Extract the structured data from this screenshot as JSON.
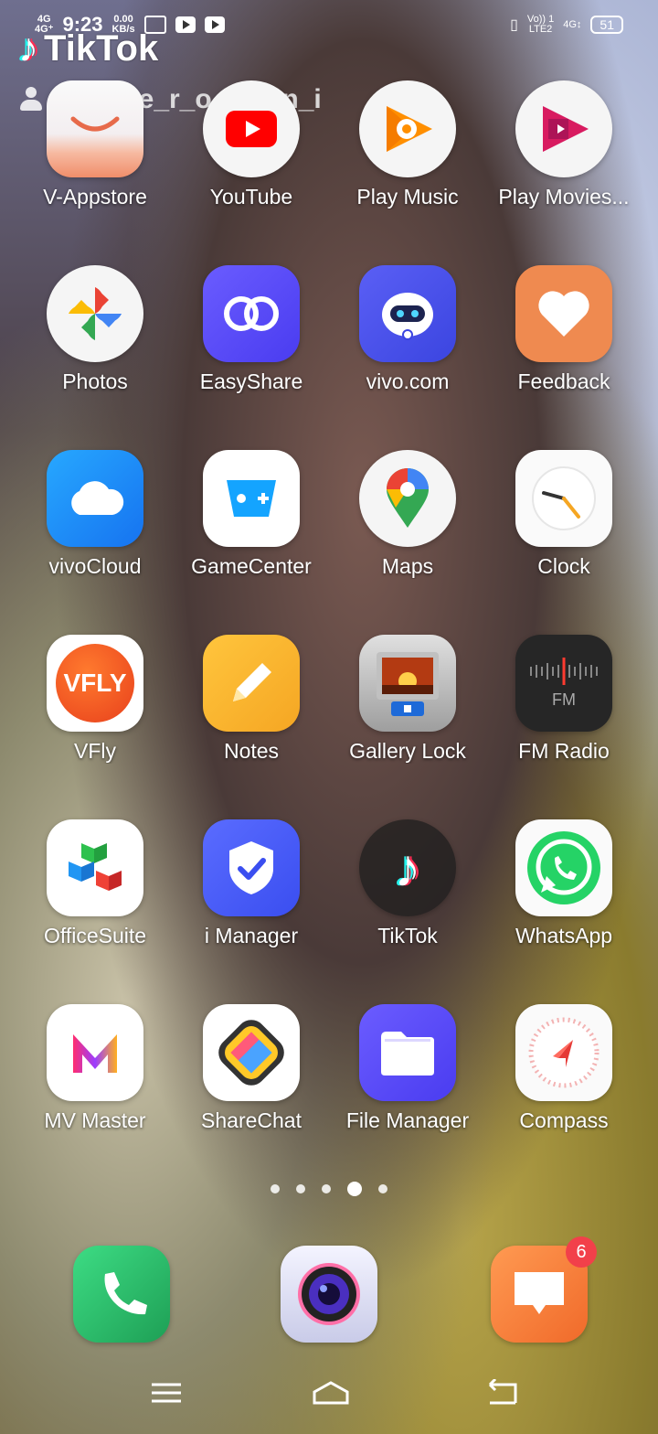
{
  "status_bar": {
    "net_left": "4G",
    "net_left2": "4G⁺",
    "time": "9:23",
    "speed_value": "0.00",
    "speed_unit": "KB/s",
    "volte": "Vo)) 1",
    "lte": "LTE2",
    "net_right": "4G↕",
    "battery": "51"
  },
  "watermark": {
    "brand": "TikTok",
    "username": "@u_s_e_r_o_h_i_n_i"
  },
  "apps": [
    {
      "label": "V-Appstore"
    },
    {
      "label": "YouTube"
    },
    {
      "label": "Play Music"
    },
    {
      "label": "Play Movies..."
    },
    {
      "label": "Photos"
    },
    {
      "label": "EasyShare"
    },
    {
      "label": "vivo.com"
    },
    {
      "label": "Feedback"
    },
    {
      "label": "vivoCloud"
    },
    {
      "label": "GameCenter"
    },
    {
      "label": "Maps"
    },
    {
      "label": "Clock"
    },
    {
      "label": "VFly"
    },
    {
      "label": "Notes"
    },
    {
      "label": "Gallery Lock"
    },
    {
      "label": "FM Radio"
    },
    {
      "label": "OfficeSuite"
    },
    {
      "label": "i Manager"
    },
    {
      "label": "TikTok"
    },
    {
      "label": "WhatsApp"
    },
    {
      "label": "MV Master"
    },
    {
      "label": "ShareChat"
    },
    {
      "label": "File Manager"
    },
    {
      "label": "Compass"
    }
  ],
  "vfly_text": "VFLY",
  "fm_text": "FM",
  "dock": {
    "messages_badge": "6"
  }
}
